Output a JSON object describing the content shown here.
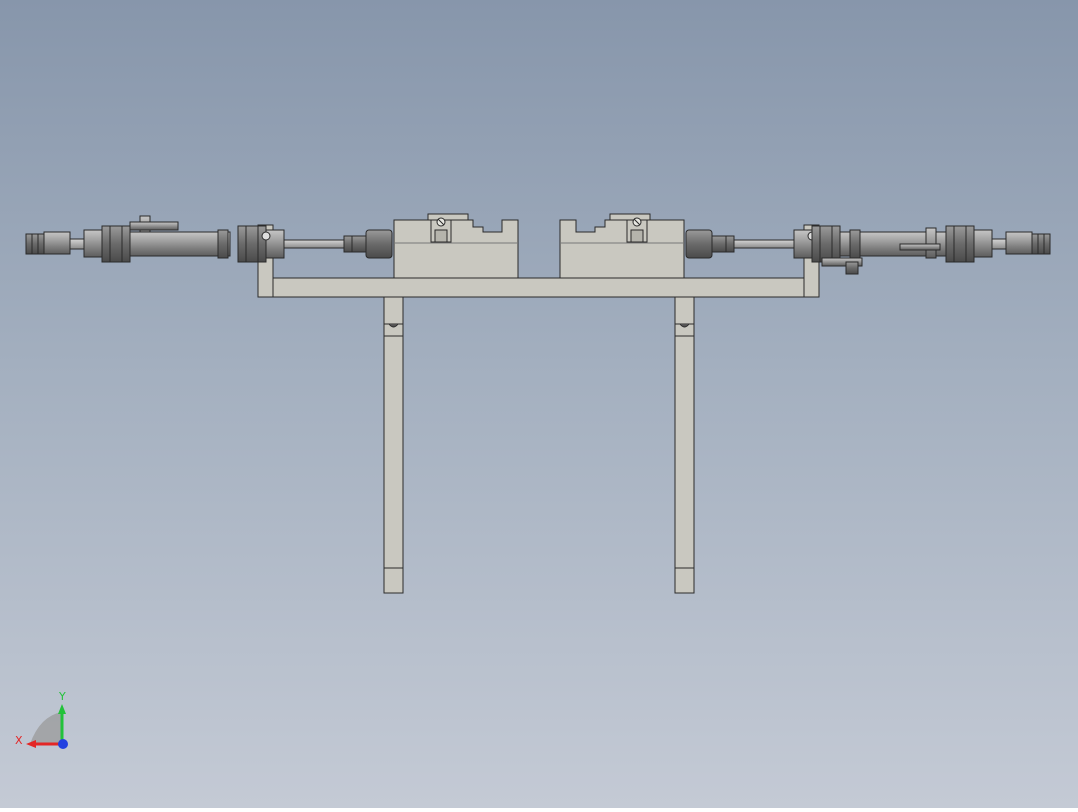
{
  "viewport": {
    "background_top": "#8796ab",
    "background_bottom": "#c4cad5"
  },
  "model": {
    "part_color": "#c9c8c0",
    "cylinder_color": "#8e8e8e",
    "edge_color": "#2a2a2a"
  },
  "triad": {
    "x_label": "X",
    "y_label": "Y",
    "x_color": "#e32626",
    "y_color": "#22c23a",
    "z_color": "#2240e0"
  }
}
